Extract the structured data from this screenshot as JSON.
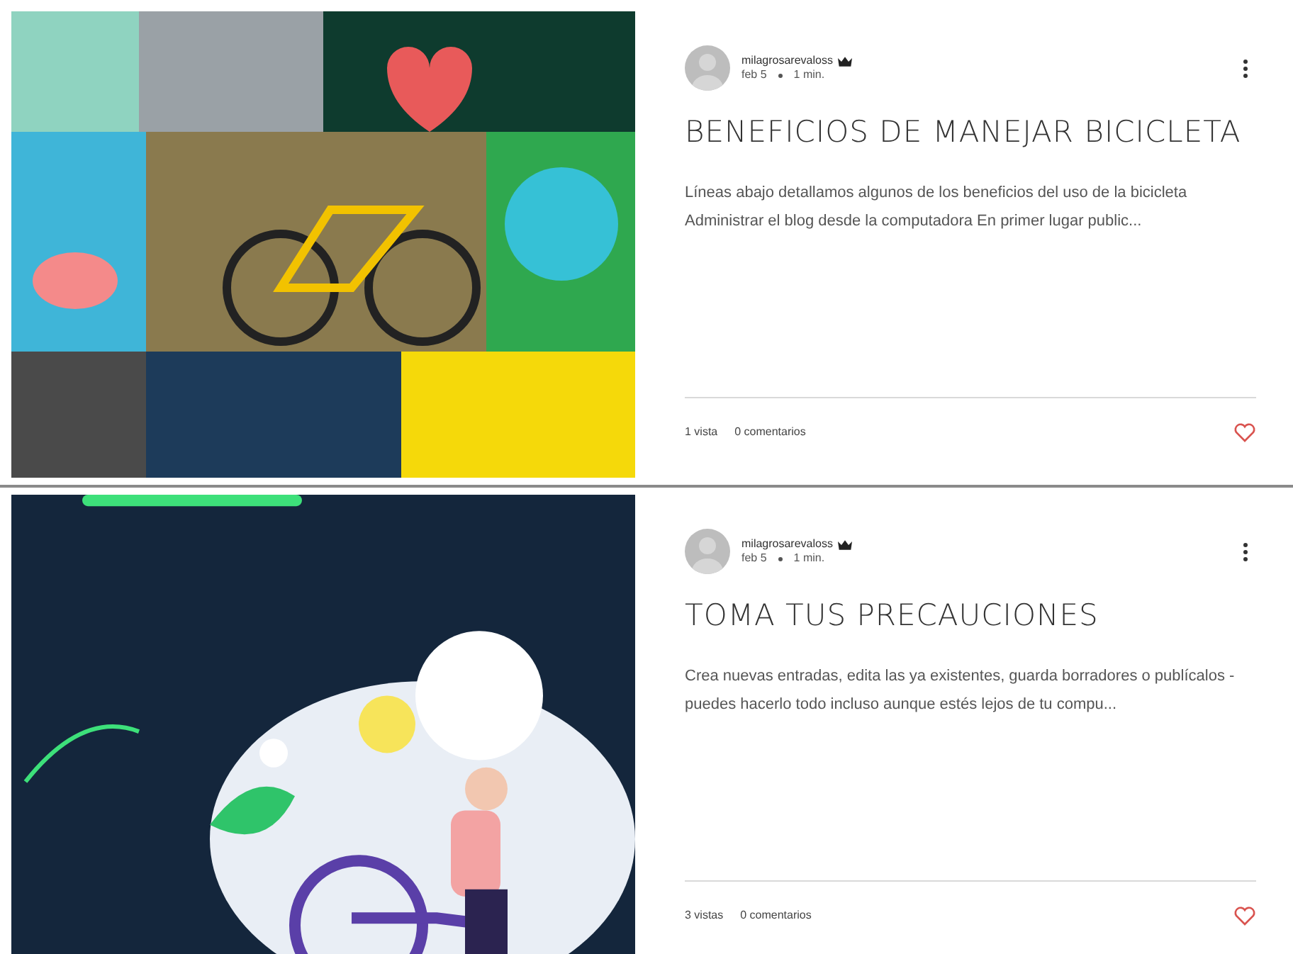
{
  "posts": [
    {
      "author": "milagrosarevaloss",
      "date": "feb 5",
      "read_time": "1 min.",
      "title": "BENEFICIOS DE MANEJAR BICICLETA",
      "excerpt": "Líneas abajo detallamos algunos de los beneficios del uso de la bicicleta Administrar el blog desde la computadora En primer lugar public...",
      "views": "1 vista",
      "comments": "0 comentarios"
    },
    {
      "author": "milagrosarevaloss",
      "date": "feb 5",
      "read_time": "1 min.",
      "title": "TOMA TUS PRECAUCIONES",
      "excerpt": "Crea nuevas entradas, edita las ya existentes, guarda borradores o publícalos -puedes hacerlo todo incluso aunque estés lejos de tu compu...",
      "views": "3 vistas",
      "comments": "0 comentarios"
    }
  ]
}
